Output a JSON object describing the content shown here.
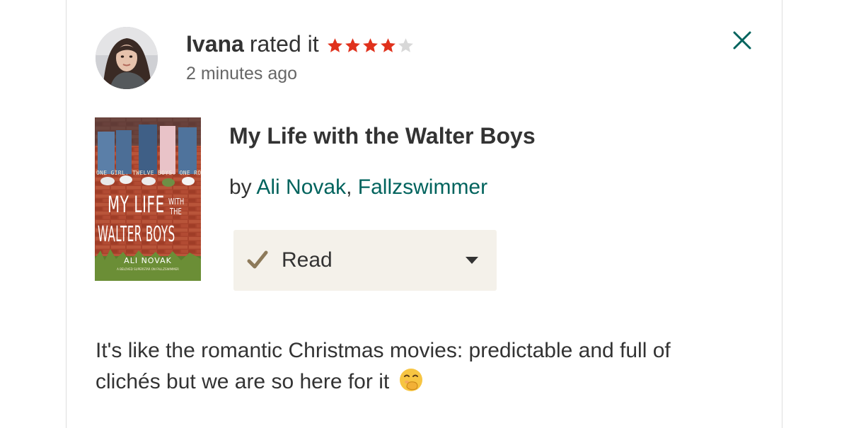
{
  "update": {
    "user_name": "Ivana",
    "action_text": "rated it",
    "rating": 4,
    "rating_max": 5,
    "timestamp": "2 minutes ago"
  },
  "book": {
    "title": "My Life with the Walter Boys",
    "by_label": "by",
    "authors": [
      "Ali Novak",
      "Fallzswimmer"
    ],
    "author_separator": ",",
    "cover": {
      "tagline": "ONE GIRL. TWELVE BOYS. ONE ROOF.",
      "title_line1": "MY LIFE",
      "title_with": "WITH",
      "title_the": "THE",
      "title_line2": "WALTER BOYS",
      "author": "ALI NOVAK",
      "blurb": "A BELOVED SUPERSTAR ON FALLZSWIMMER"
    }
  },
  "shelf": {
    "label": "Read",
    "check_icon": "check-icon",
    "dropdown_icon": "caret-down-icon"
  },
  "review": {
    "text": "It's like the romantic Christmas movies: predictable and full of clichés but we are so here for it",
    "emoji_icon": "hand-over-mouth-emoji"
  },
  "colors": {
    "link": "#00635d",
    "star_filled": "#e0311c",
    "star_empty": "#d8d8d8",
    "shelf_bg": "#f4f1ea",
    "check": "#8d7a5a"
  }
}
